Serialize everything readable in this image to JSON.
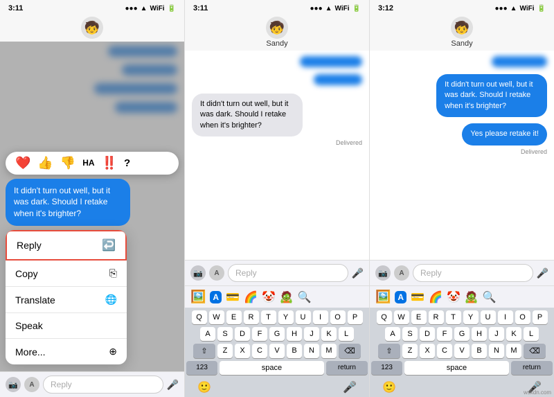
{
  "panels": [
    {
      "id": "panel1",
      "statusBar": {
        "time": "3:11",
        "icons": "●●● ▲ WiFi Bat"
      },
      "header": {
        "avatar": "🧒",
        "name": ""
      },
      "messages": [
        {
          "type": "sent",
          "text": "",
          "blurred": true
        },
        {
          "type": "sent",
          "text": "",
          "blurred": true
        },
        {
          "type": "sent",
          "text": "",
          "blurred": true
        }
      ],
      "contextBubble": "It didn't turn out well, but it was dark. Should I retake when it's brighter?",
      "reactionBar": [
        "❤️",
        "👍",
        "👎",
        "😄",
        "‼️",
        "❓"
      ],
      "contextMenu": [
        {
          "label": "Reply",
          "icon": "↩",
          "highlighted": true
        },
        {
          "label": "Copy",
          "icon": "⎘"
        },
        {
          "label": "Translate",
          "icon": "🌐"
        },
        {
          "label": "Speak",
          "icon": ""
        },
        {
          "label": "More...",
          "icon": "⊕"
        }
      ],
      "inputBar": {
        "cameraIcon": "📷",
        "appIcon": "A",
        "placeholder": "Reply",
        "micIcon": "🎤"
      }
    },
    {
      "id": "panel2",
      "statusBar": {
        "time": "3:11",
        "icons": "●●● ▲ WiFi Bat"
      },
      "header": {
        "avatar": "🧒",
        "name": "Sandy"
      },
      "messages": [
        {
          "type": "sent",
          "text": "",
          "blurred": true
        },
        {
          "type": "sent",
          "text": "",
          "blurred": true
        }
      ],
      "mainBubble": "It didn't turn out well, but it was dark. Should I retake when it's brighter?",
      "delivered": "Delivered",
      "inputBar": {
        "placeholder": "Reply"
      },
      "appIcons": [
        "📷",
        "🅰️",
        "💳",
        "🌈",
        "🤡",
        "🧟",
        "🔍"
      ],
      "keyboard": {
        "rows": [
          [
            "Q",
            "W",
            "E",
            "R",
            "T",
            "Y",
            "U",
            "I",
            "O",
            "P"
          ],
          [
            "A",
            "S",
            "D",
            "F",
            "G",
            "H",
            "J",
            "K",
            "L"
          ],
          [
            "Z",
            "X",
            "C",
            "V",
            "B",
            "N",
            "M"
          ]
        ],
        "bottomRow": [
          "123",
          "space",
          "return"
        ]
      }
    },
    {
      "id": "panel3",
      "statusBar": {
        "time": "3:12",
        "icons": "●●● ▲ WiFi Bat"
      },
      "header": {
        "avatar": "🧒",
        "name": "Sandy"
      },
      "messages": [
        {
          "type": "sent",
          "text": "",
          "blurred": true
        }
      ],
      "mainBubble": "It didn't turn out well, but it was dark. Should I retake when it's brighter?",
      "replyBubble": "Yes please retake it!",
      "delivered": "Delivered",
      "inputBar": {
        "placeholder": "Reply"
      },
      "appIcons": [
        "📷",
        "🅰️",
        "💳",
        "🌈",
        "🤡",
        "🧟",
        "🔍"
      ],
      "keyboard": {
        "rows": [
          [
            "Q",
            "W",
            "E",
            "R",
            "T",
            "Y",
            "U",
            "I",
            "O",
            "P"
          ],
          [
            "A",
            "S",
            "D",
            "F",
            "G",
            "H",
            "J",
            "K",
            "L"
          ],
          [
            "Z",
            "X",
            "C",
            "V",
            "B",
            "N",
            "M"
          ]
        ],
        "bottomRow": [
          "123",
          "space",
          "return"
        ]
      }
    }
  ],
  "watermark": "wsxdn.com"
}
